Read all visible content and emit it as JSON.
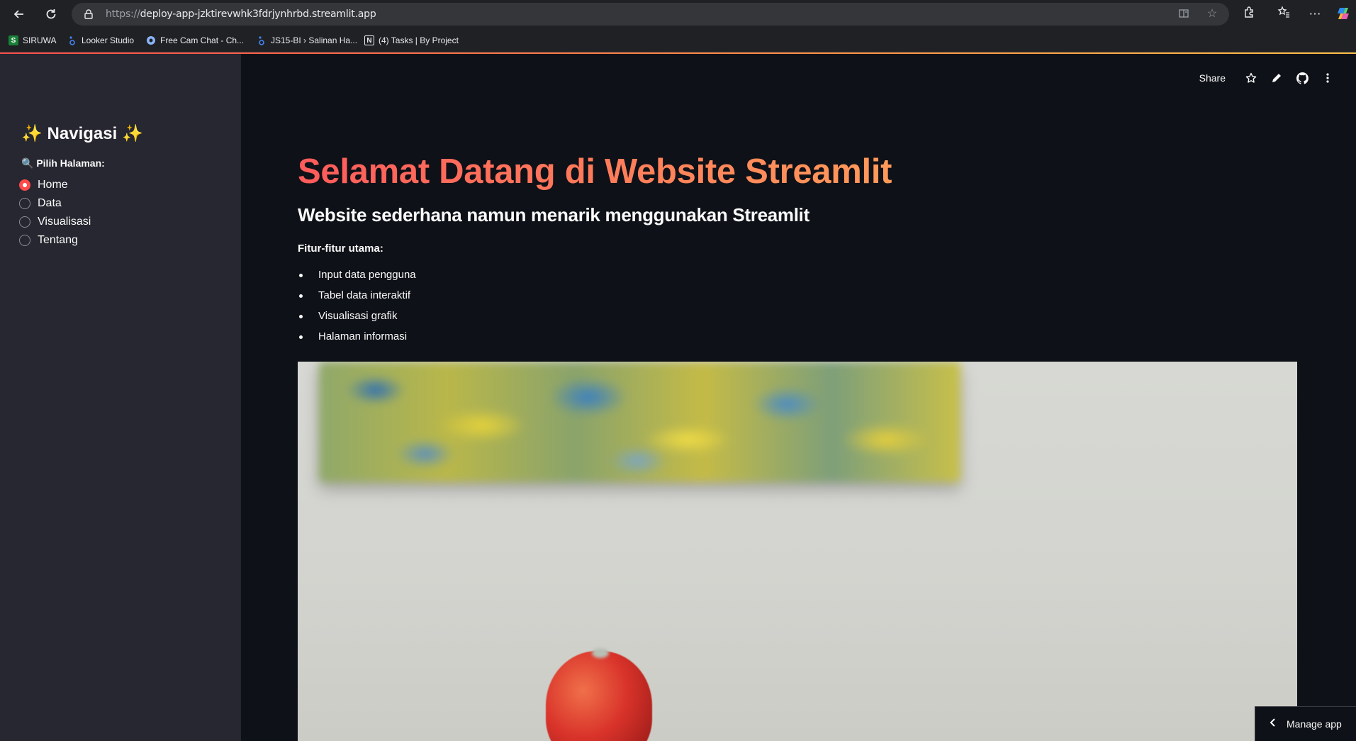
{
  "browser": {
    "url_protocol": "https://",
    "url_host": "deploy-app-jzktirevwhk3fdrjynhrbd.streamlit.app",
    "bookmarks": [
      {
        "label": "SIRUWA",
        "icon": "S",
        "color": "#188038"
      },
      {
        "label": "Looker Studio",
        "icon": "looker-icon",
        "color": "#4285f4"
      },
      {
        "label": "Free Cam Chat - Ch...",
        "icon": "chat-icon",
        "color": "#8ab4f8"
      },
      {
        "label": "JS15-BI › Salinan Ha...",
        "icon": "looker-icon",
        "color": "#4285f4"
      },
      {
        "label": "(4) Tasks | By Project",
        "icon": "N",
        "color": "#e8eaed"
      }
    ]
  },
  "sidebar": {
    "title": "✨ Navigasi ✨",
    "radio_label": "🔍 Pilih Halaman:",
    "options": [
      "Home",
      "Data",
      "Visualisasi",
      "Tentang"
    ],
    "selected": "Home"
  },
  "header": {
    "share_label": "Share"
  },
  "main": {
    "title": "Selamat Datang di Website Streamlit",
    "subtitle": "Website sederhana namun menarik menggunakan Streamlit",
    "features_label": "Fitur-fitur utama:",
    "features": [
      "Input data pengguna",
      "Tabel data interaktif",
      "Visualisasi grafik",
      "Halaman informasi"
    ]
  },
  "manage_app": {
    "label": "Manage app"
  },
  "colors": {
    "accent": "#ff4b4b",
    "background": "#0e1117",
    "sidebar": "#262730"
  }
}
